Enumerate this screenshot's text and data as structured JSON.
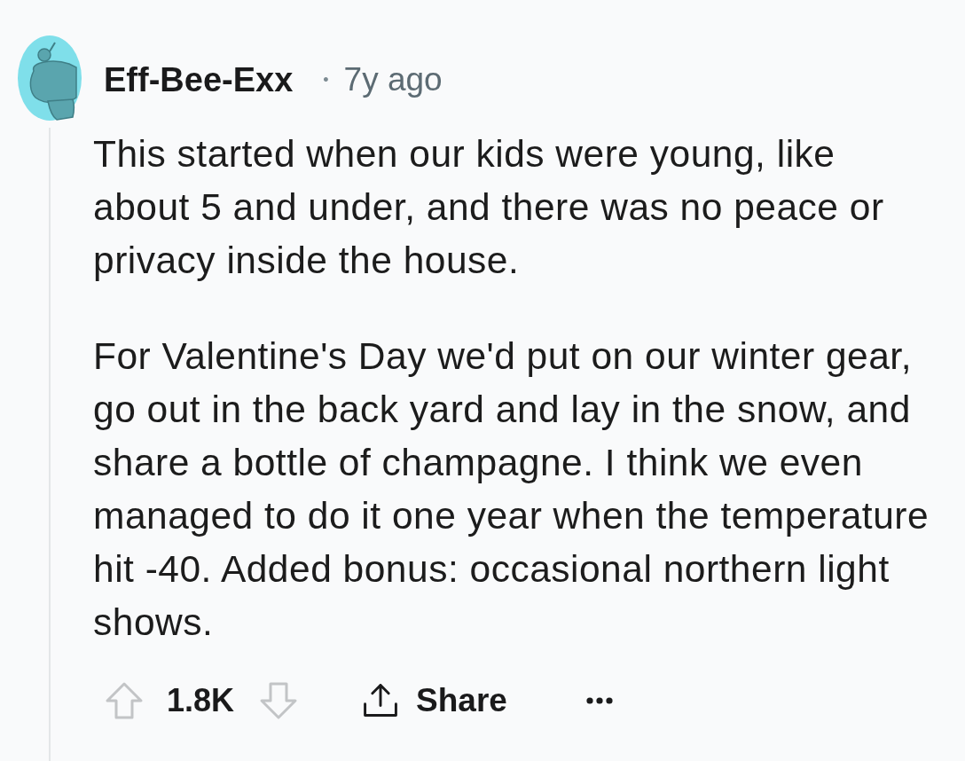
{
  "comment": {
    "author": "Eff-Bee-Exx",
    "separator": "•",
    "age": "7y ago",
    "paragraphs": [
      "This started when our kids were young, like about 5 and under, and there was no peace or privacy inside the house.",
      "For Valentine's Day we'd put on our winter gear, go out in the back yard and lay in the snow, and share a bottle of champagne. I think we even managed to do it one year when the temperature hit -40. Added bonus: occasional northern light shows."
    ],
    "actions": {
      "score": "1.8K",
      "share_label": "Share"
    }
  }
}
